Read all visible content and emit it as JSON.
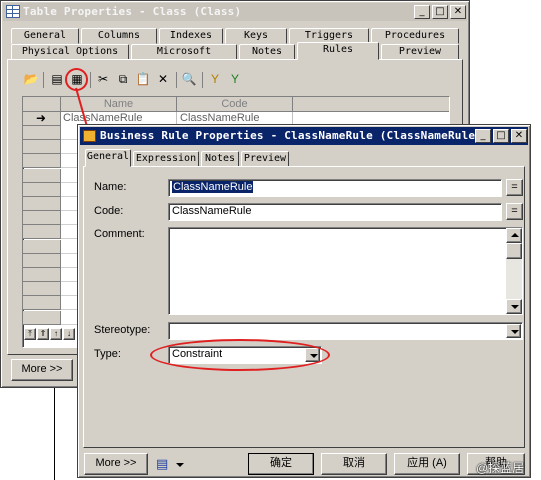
{
  "back_window": {
    "title": "Table Properties - Class (Class)",
    "tabs_row1": [
      "General",
      "Columns",
      "Indexes",
      "Keys",
      "Triggers",
      "Procedures"
    ],
    "tabs_row2": [
      "Physical Options",
      "Microsoft",
      "Notes",
      "Rules",
      "Preview"
    ],
    "selected_tab": "Rules",
    "grid": {
      "columns": [
        "Name",
        "Code"
      ],
      "rows": [
        {
          "marker": "➜",
          "name": "ClassNameRule",
          "code": "ClassNameRule"
        }
      ]
    },
    "more_button": "More >>"
  },
  "front_window": {
    "title": "Business Rule Properties - ClassNameRule (ClassNameRule)",
    "tabs": [
      "General",
      "Expression",
      "Notes",
      "Preview"
    ],
    "selected_tab": "General",
    "form": {
      "name_label": "Name:",
      "name_value": "ClassNameRule",
      "code_label": "Code:",
      "code_value": "ClassNameRule",
      "comment_label": "Comment:",
      "comment_value": "",
      "stereotype_label": "Stereotype:",
      "stereotype_value": "",
      "type_label": "Type:",
      "type_value": "Constraint",
      "eq_button": "="
    },
    "buttons": {
      "more": "More >>",
      "ok": "确定",
      "cancel": "取消",
      "apply": "应用 (A)",
      "help": "帮助"
    }
  },
  "watermark": "@探蓝居",
  "colors": {
    "active_title": "#0a246a",
    "highlight": "#0a246a",
    "annotation_red": "#e02020"
  }
}
